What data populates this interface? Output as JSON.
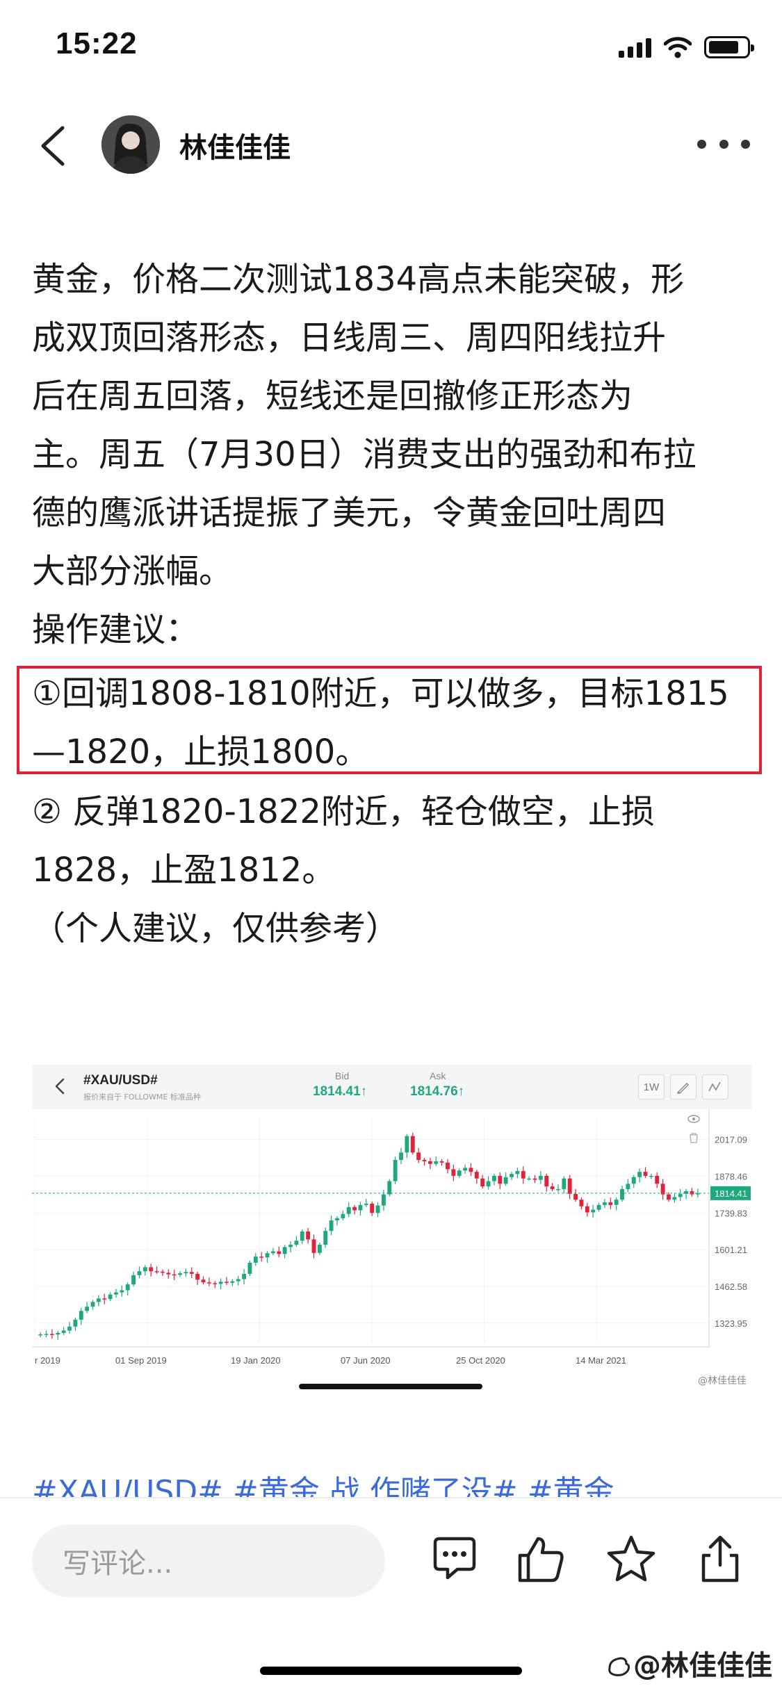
{
  "status_bar": {
    "time": "15:22"
  },
  "header": {
    "author_name": "林佳佳佳"
  },
  "article": {
    "lines": [
      "黄金，价格二次测试1834高点未能突破，形",
      "成双顶回落形态，日线周三、周四阳线拉升",
      "后在周五回落，短线还是回撤修正形态为",
      "主。周五（7月30日）消费支出的强劲和布拉",
      "德的鹰派讲话提振了美元，令黄金回吐周四",
      "大部分涨幅。",
      "操作建议："
    ],
    "highlight_lines": [
      "①回调1808-1810附近，可以做多，目标1815",
      "—1820，止损1800。"
    ],
    "after_lines": [
      " ② 反弹1820-1822附近，轻仓做空，止损",
      "1828，止盈1812。",
      "（个人建议，仅供参考）"
    ]
  },
  "chart": {
    "symbol": "#XAU/USD#",
    "source": "报价来自于 FOLLOWME 标准品种",
    "bid_label": "Bid",
    "bid_value": "1814.41↑",
    "ask_label": "Ask",
    "ask_value": "1814.76↑",
    "tool_period": "1W",
    "watermark": "@林佳佳佳",
    "current_price": "1814.41",
    "colors": {
      "up": "#1fa77e",
      "down": "#e0223a",
      "price_line": "#1fa77e"
    }
  },
  "chart_data": {
    "type": "candlestick",
    "title": "#XAU/USD#",
    "y_ticks": [
      "2017.09",
      "1878.46",
      "1739.83",
      "1601.21",
      "1462.58",
      "1323.95"
    ],
    "x_ticks": [
      "r 2019",
      "01 Sep 2019",
      "19 Jan 2020",
      "07 Jun 2020",
      "25 Oct 2020",
      "14 Mar 2021"
    ],
    "ylim": [
      1250,
      2100
    ],
    "last_price": 1814.41,
    "closes": [
      1282,
      1283,
      1281,
      1287,
      1296,
      1311,
      1337,
      1370,
      1386,
      1404,
      1417,
      1415,
      1432,
      1440,
      1448,
      1470,
      1505,
      1520,
      1535,
      1520,
      1518,
      1514,
      1508,
      1506,
      1512,
      1517,
      1510,
      1488,
      1478,
      1475,
      1472,
      1480,
      1476,
      1482,
      1490,
      1510,
      1552,
      1575,
      1572,
      1588,
      1595,
      1585,
      1611,
      1620,
      1635,
      1670,
      1640,
      1589,
      1620,
      1672,
      1712,
      1720,
      1736,
      1762,
      1750,
      1770,
      1775,
      1740,
      1768,
      1810,
      1860,
      1940,
      1968,
      2030,
      1968,
      1940,
      1935,
      1925,
      1935,
      1930,
      1905,
      1880,
      1900,
      1910,
      1895,
      1870,
      1840,
      1860,
      1880,
      1850,
      1875,
      1887,
      1898,
      1870,
      1870,
      1865,
      1880,
      1840,
      1830,
      1830,
      1870,
      1812,
      1790,
      1765,
      1742,
      1752,
      1770,
      1780,
      1770,
      1790,
      1830,
      1850,
      1875,
      1895,
      1880,
      1880,
      1850,
      1810,
      1790,
      1800,
      1812,
      1822,
      1810,
      1814
    ]
  },
  "footer": {
    "tags_partial": "#XAU/USD#  #黄金  战  作赌了没#  #黄金",
    "comment_placeholder": "写评论...",
    "watermark": "@林佳佳佳"
  }
}
